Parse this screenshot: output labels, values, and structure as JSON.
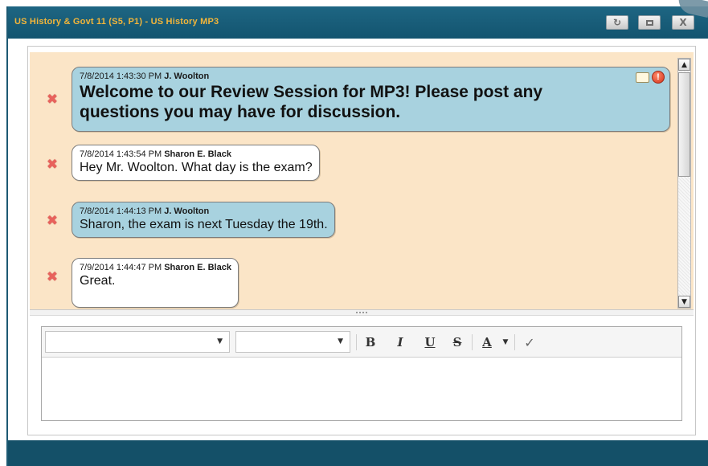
{
  "window": {
    "title": "US History & Govt 11 (S5, P1) - US History MP3",
    "buttons": {
      "refresh_icon": "refresh-icon",
      "restore_icon": "restore-icon",
      "close_label": "X"
    }
  },
  "messages": [
    {
      "timestamp": "7/8/2014 1:43:30 PM",
      "author": "J. Woolton",
      "role": "teacher",
      "text": "Welcome to our Review Session for MP3! Please post any questions you may have for discussion."
    },
    {
      "timestamp": "7/8/2014 1:43:54 PM",
      "author": "Sharon E. Black",
      "role": "student",
      "text": "Hey Mr. Woolton. What day is the exam?"
    },
    {
      "timestamp": "7/8/2014 1:44:13 PM",
      "author": "J. Woolton",
      "role": "teacher",
      "text": "Sharon, the exam is next Tuesday the 19th."
    },
    {
      "timestamp": "7/9/2014 1:44:47 PM",
      "author": "Sharon E. Black",
      "role": "student",
      "text": "Great."
    }
  ],
  "editor": {
    "font_family_value": "",
    "font_size_value": "",
    "bold_label": "B",
    "italic_label": "I",
    "underline_label": "U",
    "strike_label": "S",
    "font_color_label": "A",
    "body_text": ""
  },
  "colors": {
    "titlebar": "#13546f",
    "title_text": "#f2b53a",
    "message_area": "#fbe5c7",
    "teacher_bubble": "#a8d2df",
    "student_bubble": "#ffffff",
    "delete_icon": "#e8625c"
  }
}
